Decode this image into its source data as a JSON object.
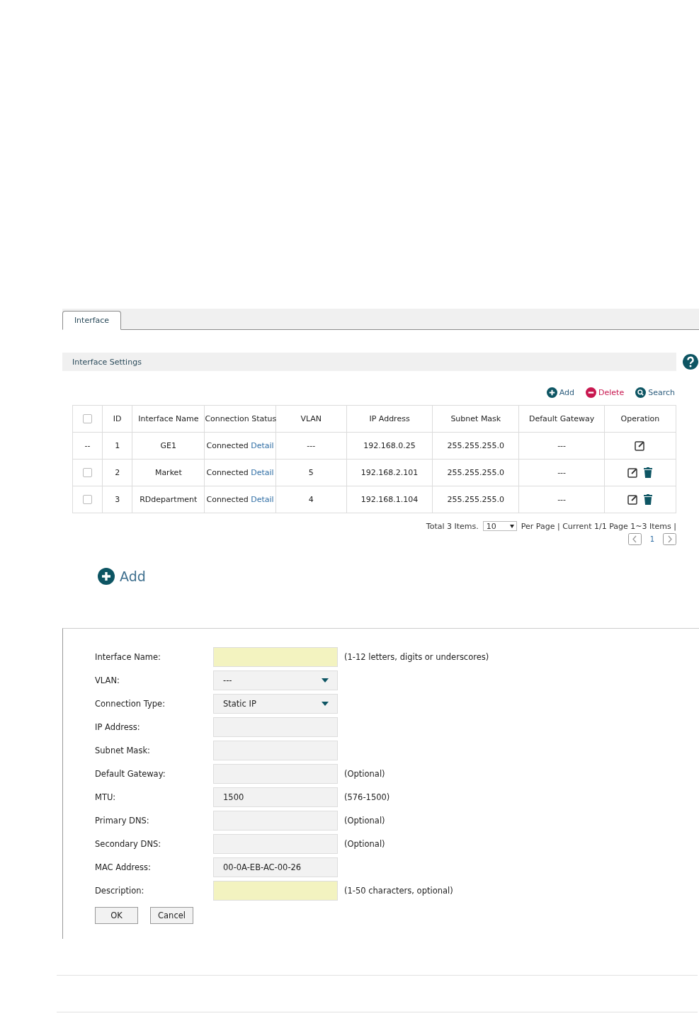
{
  "tabs": [
    {
      "label": "Interface",
      "selected": true
    }
  ],
  "section": {
    "title": "Interface Settings"
  },
  "toolbar": [
    {
      "kind": "add",
      "label": "Add"
    },
    {
      "kind": "delete",
      "label": "Delete"
    },
    {
      "kind": "search",
      "label": "Search"
    }
  ],
  "table": {
    "header_checked": false,
    "columns": [
      "ID",
      "Interface Name",
      "Connection Status",
      "VLAN",
      "IP Address",
      "Subnet Mask",
      "Default Gateway",
      "Operation"
    ],
    "rows": [
      {
        "kind": "fixed",
        "select_text": "--",
        "id": "1",
        "name": "GE1",
        "status": "Connected",
        "link": "Detail",
        "vlan": "---",
        "ip": "192.168.0.25",
        "mask": "255.255.255.0",
        "gateway": "---",
        "deletable": false
      },
      {
        "kind": "selectable",
        "checked": false,
        "id": "2",
        "name": "Market",
        "status": "Connected",
        "link": "Detail",
        "vlan": "5",
        "ip": "192.168.2.101",
        "mask": "255.255.255.0",
        "gateway": "---",
        "deletable": true
      },
      {
        "kind": "selectable",
        "checked": false,
        "id": "3",
        "name": "RDdepartment",
        "status": "Connected",
        "link": "Detail",
        "vlan": "4",
        "ip": "192.168.1.104",
        "mask": "255.255.255.0",
        "gateway": "---",
        "deletable": true
      }
    ]
  },
  "pager": {
    "total": "Total 3 Items.",
    "per_page": "10",
    "info": "Per Page | Current 1/1 Page 1~3 Items |",
    "page": "1"
  },
  "add_button": {
    "label": "Add"
  },
  "form": {
    "fields": [
      {
        "kind": "text",
        "label": "Interface Name:",
        "required": true,
        "hint": "(1-12 letters, digits or underscores)"
      },
      {
        "kind": "select",
        "label": "VLAN:",
        "value": "---"
      },
      {
        "kind": "select",
        "label": "Connection Type:",
        "value": "Static IP"
      },
      {
        "kind": "text",
        "label": "IP Address:",
        "required": false
      },
      {
        "kind": "text",
        "label": "Subnet Mask:",
        "required": false
      },
      {
        "kind": "text",
        "label": "Default Gateway:",
        "required": false,
        "hint": "(Optional)"
      },
      {
        "kind": "text",
        "label": "MTU:",
        "required": false,
        "value": "1500",
        "hint": "(576-1500)"
      },
      {
        "kind": "text",
        "label": "Primary DNS:",
        "required": false,
        "hint": "(Optional)"
      },
      {
        "kind": "text",
        "label": "Secondary DNS:",
        "required": false,
        "hint": "(Optional)"
      },
      {
        "kind": "text",
        "label": "MAC Address:",
        "required": false,
        "value": "00-0A-EB-AC-00-26"
      },
      {
        "kind": "text",
        "label": "Description:",
        "required": true,
        "hint": "(1-50 characters, optional)"
      }
    ],
    "buttons": [
      "OK",
      "Cancel"
    ]
  }
}
